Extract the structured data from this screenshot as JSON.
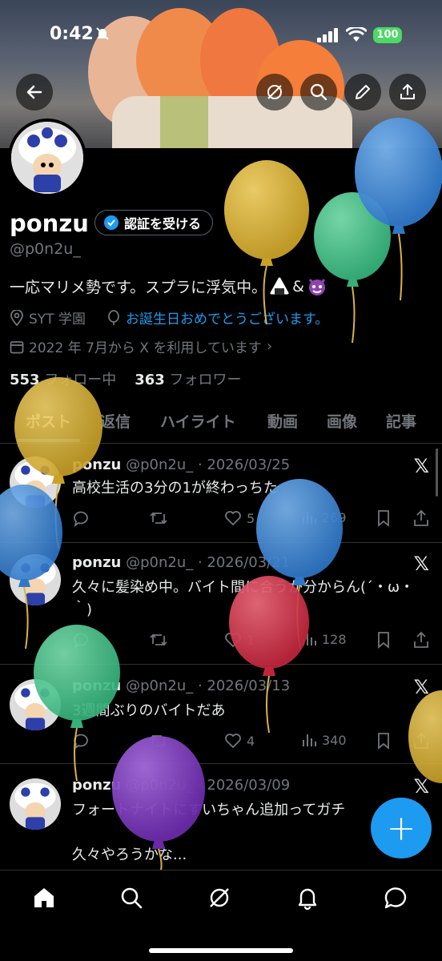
{
  "status_bar": {
    "time": "0:42",
    "battery": "100"
  },
  "profile": {
    "name": "ponzu",
    "verify_label": "認証を受ける",
    "handle": "@p0n2u_",
    "bio": "一応マリメ勢です。スプラに浮気中。",
    "bio_suffix": "&",
    "location": "SYT 学園",
    "birthday_text": "お誕生日おめでとうございます。",
    "joined": "2022 年 7月から X を利用しています",
    "following_count": "553",
    "following_label": "フォロー中",
    "followers_count": "363",
    "followers_label": "フォロワー"
  },
  "tabs": [
    "ポスト",
    "返信",
    "ハイライト",
    "動画",
    "画像",
    "記事"
  ],
  "posts": [
    {
      "name": "ponzu",
      "meta": "@p0n2u_ · 2026/03/25",
      "text": "高校生活の3分の1が終わっちた",
      "likes": "5",
      "views": "269"
    },
    {
      "name": "ponzu",
      "meta": "@p0n2u_ · 2026/03/21",
      "text": "久々に髪染め中。バイト間に合うか分からん(´・ω・｀)",
      "likes": "1",
      "views": "128"
    },
    {
      "name": "ponzu",
      "meta": "@p0n2u_ · 2026/03/13",
      "text": "3週間ぶりのバイトだあ",
      "likes": "4",
      "views": "340"
    },
    {
      "name": "ponzu",
      "meta": "@p0n2u_ · 2026/03/09",
      "text": "フォートナイトにすいちゃん追加ってガチ",
      "text2": "久々やろうかな..."
    }
  ],
  "fab_label": "+",
  "colors": {
    "accent": "#1d9bf0",
    "background": "#000000",
    "muted": "#71767b"
  },
  "icons": [
    "back-arrow-icon",
    "grok-icon",
    "search-icon",
    "edit-icon",
    "share-icon",
    "home-icon",
    "notifications-icon",
    "messages-icon"
  ]
}
